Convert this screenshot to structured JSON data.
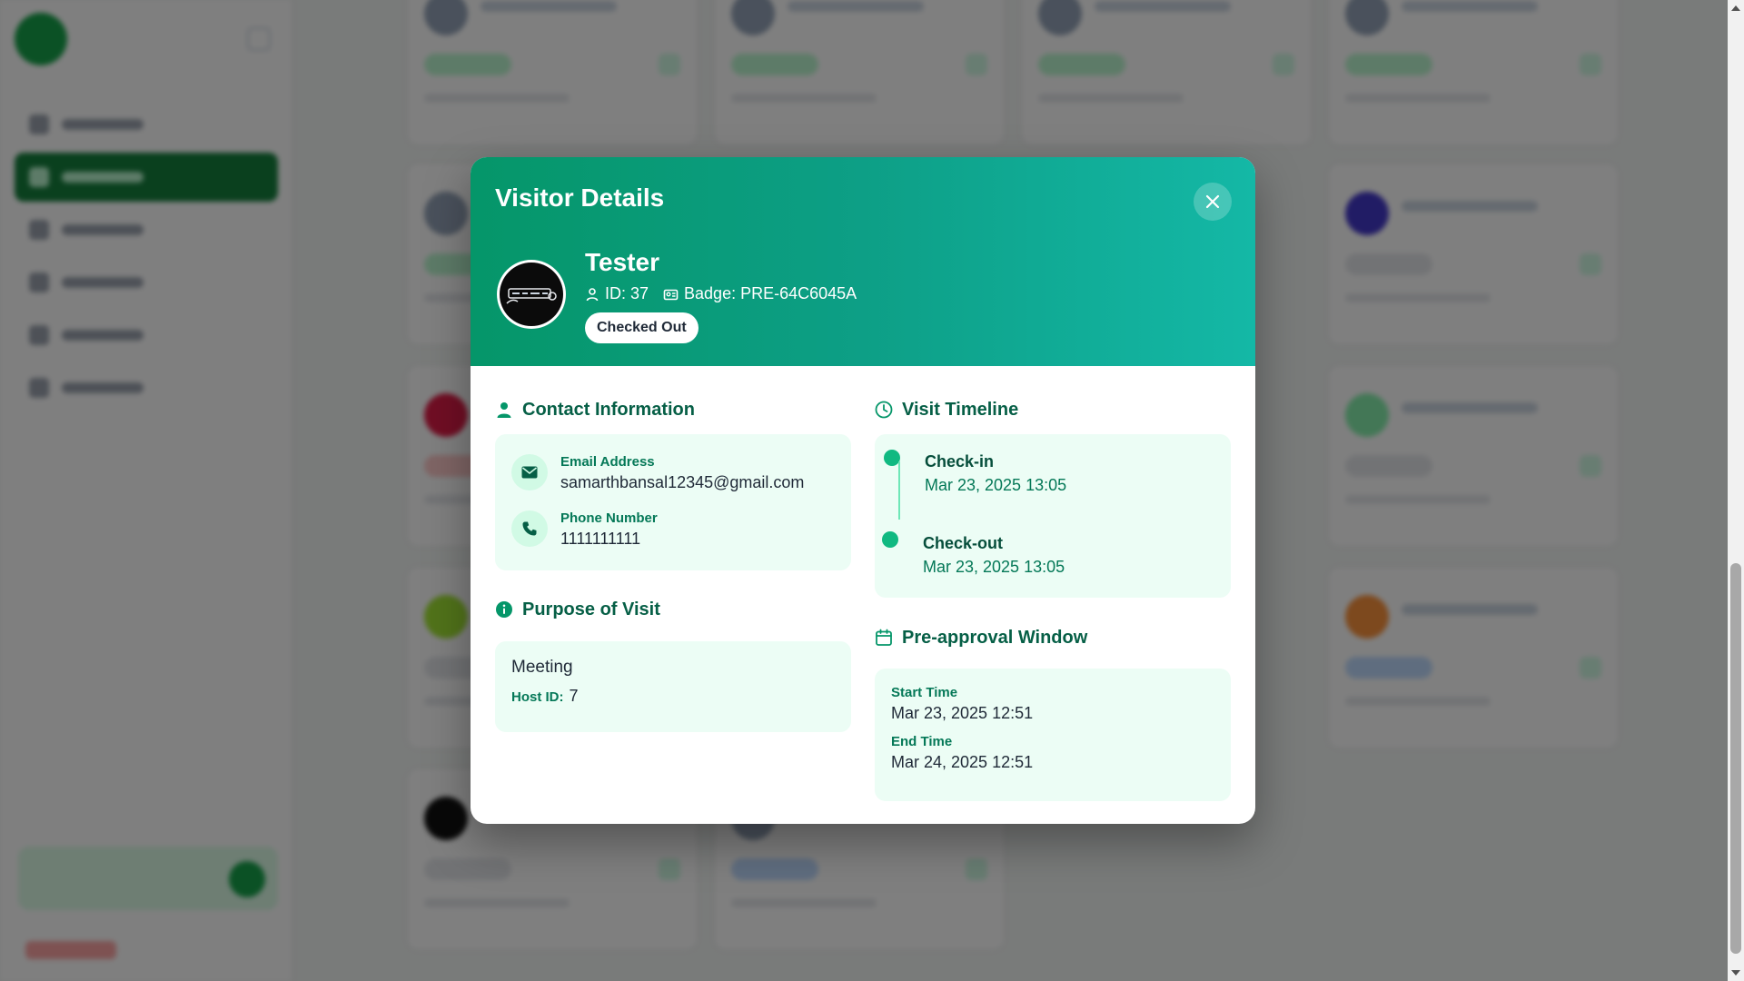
{
  "modal": {
    "title": "Visitor Details",
    "close_icon": "close-icon"
  },
  "visitor": {
    "name": "Tester",
    "id_text": "ID: 37",
    "badge_text": "Badge: PRE-64C6045A",
    "status": "Checked Out"
  },
  "contact": {
    "title": "Contact Information",
    "email_label": "Email Address",
    "email": "samarthbansal12345@gmail.com",
    "phone_label": "Phone Number",
    "phone": "1111111111"
  },
  "purpose": {
    "title": "Purpose of Visit",
    "text": "Meeting",
    "host_label": "Host ID:",
    "host_id": "7"
  },
  "timeline": {
    "title": "Visit Timeline",
    "checkin_label": "Check-in",
    "checkin_time": "Mar 23, 2025 13:05",
    "checkout_label": "Check-out",
    "checkout_time": "Mar 23, 2025 13:05"
  },
  "preapproval": {
    "title": "Pre-approval Window",
    "start_label": "Start Time",
    "start_time": "Mar 23, 2025 12:51",
    "end_label": "End Time",
    "end_time": "Mar 24, 2025 12:51"
  },
  "colors": {
    "header_gradient_start": "#059669",
    "header_gradient_end": "#14b8a6",
    "accent": "#10b981",
    "card_bg": "#ecfdf5"
  }
}
